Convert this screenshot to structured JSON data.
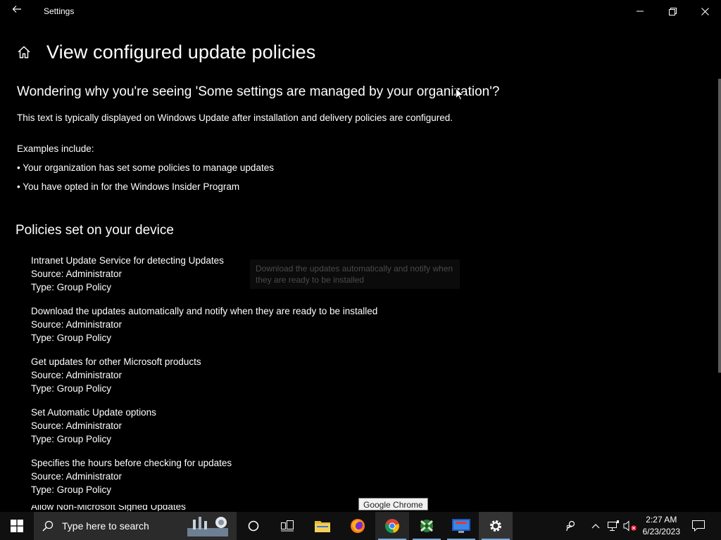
{
  "window": {
    "title": "Settings"
  },
  "header": {
    "title": "View configured update policies"
  },
  "intro": {
    "question": "Wondering why you're seeing 'Some settings are managed by your organization'?",
    "description": "This text is typically displayed on Windows Update after installation and delivery policies are configured.",
    "examples_label": "Examples include:",
    "bullets": [
      "• Your organization has set some policies to manage updates",
      "• You have opted in for the Windows Insider Program"
    ]
  },
  "policies_section": {
    "title": "Policies set on your device",
    "items": [
      {
        "name": "Intranet Update Service for detecting Updates",
        "source": "Source: Administrator",
        "type": "Type: Group Policy"
      },
      {
        "name": "Download the updates automatically and notify when they are ready to be installed",
        "source": "Source: Administrator",
        "type": "Type: Group Policy"
      },
      {
        "name": "Get updates for other Microsoft products",
        "source": "Source: Administrator",
        "type": "Type: Group Policy"
      },
      {
        "name": "Set Automatic Update options",
        "source": "Source: Administrator",
        "type": "Type: Group Policy"
      },
      {
        "name": "Specifies the hours before checking for updates",
        "source": "Source: Administrator",
        "type": "Type: Group Policy"
      },
      {
        "name": "Allow Non-Microsoft Signed Updates",
        "source": "",
        "type": ""
      }
    ]
  },
  "ghost_tooltip": {
    "text": "Download the updates automatically and notify when they are ready to be installed"
  },
  "taskbar": {
    "search_placeholder": "Type here to search",
    "hover_tooltip": "Google Chrome",
    "time": "2:27 AM",
    "date": "6/23/2023",
    "apps": [
      "cortana-icon",
      "task-view-icon",
      "file-explorer-icon",
      "firefox-icon",
      "chrome-icon",
      "xbox-icon",
      "remote-desktop-icon",
      "settings-icon"
    ]
  },
  "colors": {
    "background": "#000000",
    "text": "#ffffff",
    "taskbar": "#101010",
    "search_box": "#2b2b2b",
    "accent": "#7aa9d8"
  }
}
